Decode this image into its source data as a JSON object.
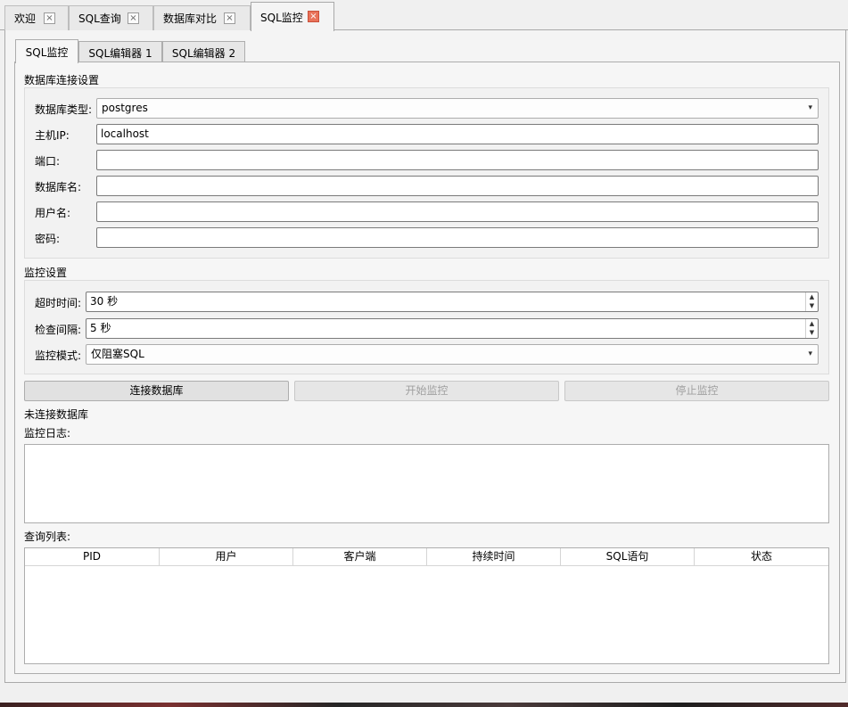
{
  "outer_tabs": [
    {
      "label": "欢迎",
      "close": "×"
    },
    {
      "label": "SQL查询",
      "close": "×"
    },
    {
      "label": "数据库对比",
      "close": "×"
    },
    {
      "label": "SQL监控",
      "close": "×"
    }
  ],
  "inner_tabs": [
    "SQL监控",
    "SQL编辑器 1",
    "SQL编辑器 2"
  ],
  "conn": {
    "title": "数据库连接设置",
    "db_type_label": "数据库类型:",
    "db_type_value": "postgres",
    "host_label": "主机IP:",
    "host_value": "localhost",
    "port_label": "端口:",
    "port_value": "",
    "dbname_label": "数据库名:",
    "dbname_value": "",
    "user_label": "用户名:",
    "user_value": "",
    "password_label": "密码:",
    "password_value": ""
  },
  "monitor": {
    "title": "监控设置",
    "timeout_label": "超时时间:",
    "timeout_value": "30 秒",
    "interval_label": "检查间隔:",
    "interval_value": "5 秒",
    "mode_label": "监控模式:",
    "mode_value": "仅阻塞SQL"
  },
  "buttons": {
    "connect": "连接数据库",
    "start": "开始监控",
    "stop": "停止监控"
  },
  "status_text": "未连接数据库",
  "log_label": "监控日志:",
  "query_list_label": "查询列表:",
  "columns": [
    "PID",
    "用户",
    "客户端",
    "持续时间",
    "SQL语句",
    "状态"
  ],
  "icons": {
    "dropdown": "▾",
    "spin_up": "▲",
    "spin_down": "▼"
  }
}
